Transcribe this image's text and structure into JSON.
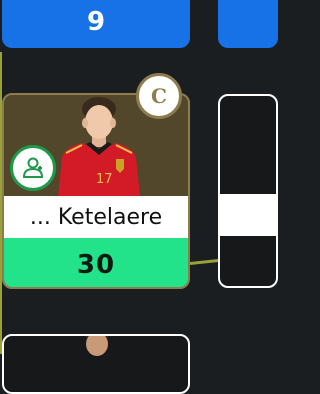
{
  "top_card": {
    "value": "9"
  },
  "player_card": {
    "name": "... Ketelaere",
    "points": "30",
    "kit_number": "17",
    "captain_label": "C",
    "badge_icon": "substitute-users-icon"
  },
  "colors": {
    "top_card_blue": "#1672e6",
    "card_gold_bg": "#53472b",
    "card_gold_border": "#8d7d4e",
    "points_green": "#22e38a",
    "sub_badge_green": "#1f9a4a",
    "pitch_line": "#9aa03a",
    "background": "#1b1e21"
  }
}
